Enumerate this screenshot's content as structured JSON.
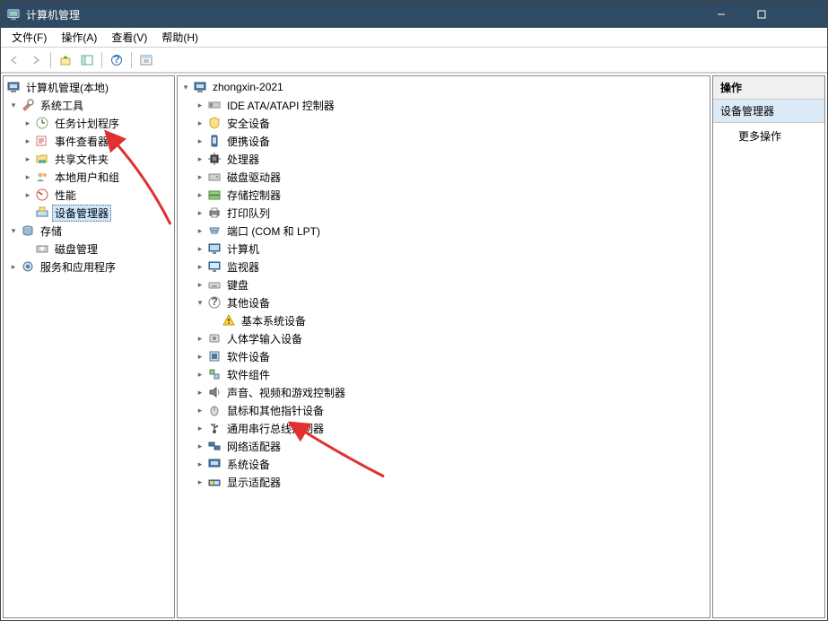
{
  "title": "计算机管理",
  "menu": {
    "file": "文件(F)",
    "action": "操作(A)",
    "view": "查看(V)",
    "help": "帮助(H)"
  },
  "left_tree": {
    "root": "计算机管理(本地)",
    "sys_tools": "系统工具",
    "task_sched": "任务计划程序",
    "event_viewer": "事件查看器",
    "shared": "共享文件夹",
    "local_users": "本地用户和组",
    "perf": "性能",
    "devmgr": "设备管理器",
    "storage": "存储",
    "diskmgmt": "磁盘管理",
    "services": "服务和应用程序"
  },
  "devices": {
    "root": "zhongxin-2021",
    "ide": "IDE ATA/ATAPI 控制器",
    "security": "安全设备",
    "portable": "便携设备",
    "cpu": "处理器",
    "diskdrive": "磁盘驱动器",
    "storagectl": "存储控制器",
    "printq": "打印队列",
    "ports": "端口 (COM 和 LPT)",
    "computer": "计算机",
    "monitor": "监视器",
    "keyboard": "键盘",
    "other": "其他设备",
    "basesys": "基本系统设备",
    "hid": "人体学输入设备",
    "softdev": "软件设备",
    "softcomp": "软件组件",
    "audio": "声音、视频和游戏控制器",
    "mouse": "鼠标和其他指针设备",
    "usb": "通用串行总线控制器",
    "netadapter": "网络适配器",
    "sysdev": "系统设备",
    "display": "显示适配器"
  },
  "actions": {
    "header": "操作",
    "current": "设备管理器",
    "more": "更多操作"
  }
}
